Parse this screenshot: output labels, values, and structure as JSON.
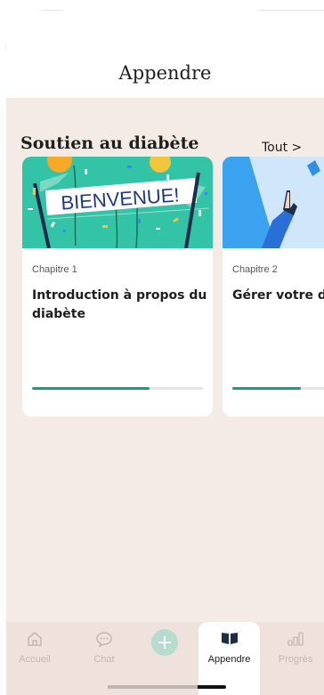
{
  "header": {
    "title": "Appendre"
  },
  "section": {
    "title": "Soutien au diabète",
    "see_all": "Tout >"
  },
  "cards": [
    {
      "chapter": "Chapitre 1",
      "title_line1": "Introduction à propos du",
      "title_line2": "diabète",
      "banner_text": "BIENVENUE!",
      "progress": 0.69
    },
    {
      "chapter": "Chapitre 2",
      "title_line1": "Gérer votre di",
      "title_line2": "",
      "progress": 0.4
    }
  ],
  "tabbar": {
    "home": {
      "label": "Accueil",
      "icon": "home-icon"
    },
    "chat": {
      "label": "Chat",
      "icon": "chat-icon"
    },
    "add": {
      "icon": "plus-icon"
    },
    "learn": {
      "label": "Appendre",
      "icon": "book-icon"
    },
    "progress": {
      "label": "Progrès",
      "icon": "chart-icon"
    }
  },
  "colors": {
    "accent": "#12a083",
    "background": "#f5ebe6",
    "tabbar": "#efe2dc",
    "banner_teal": "#33c3a6",
    "banner_blue": "#2f8fe5"
  }
}
